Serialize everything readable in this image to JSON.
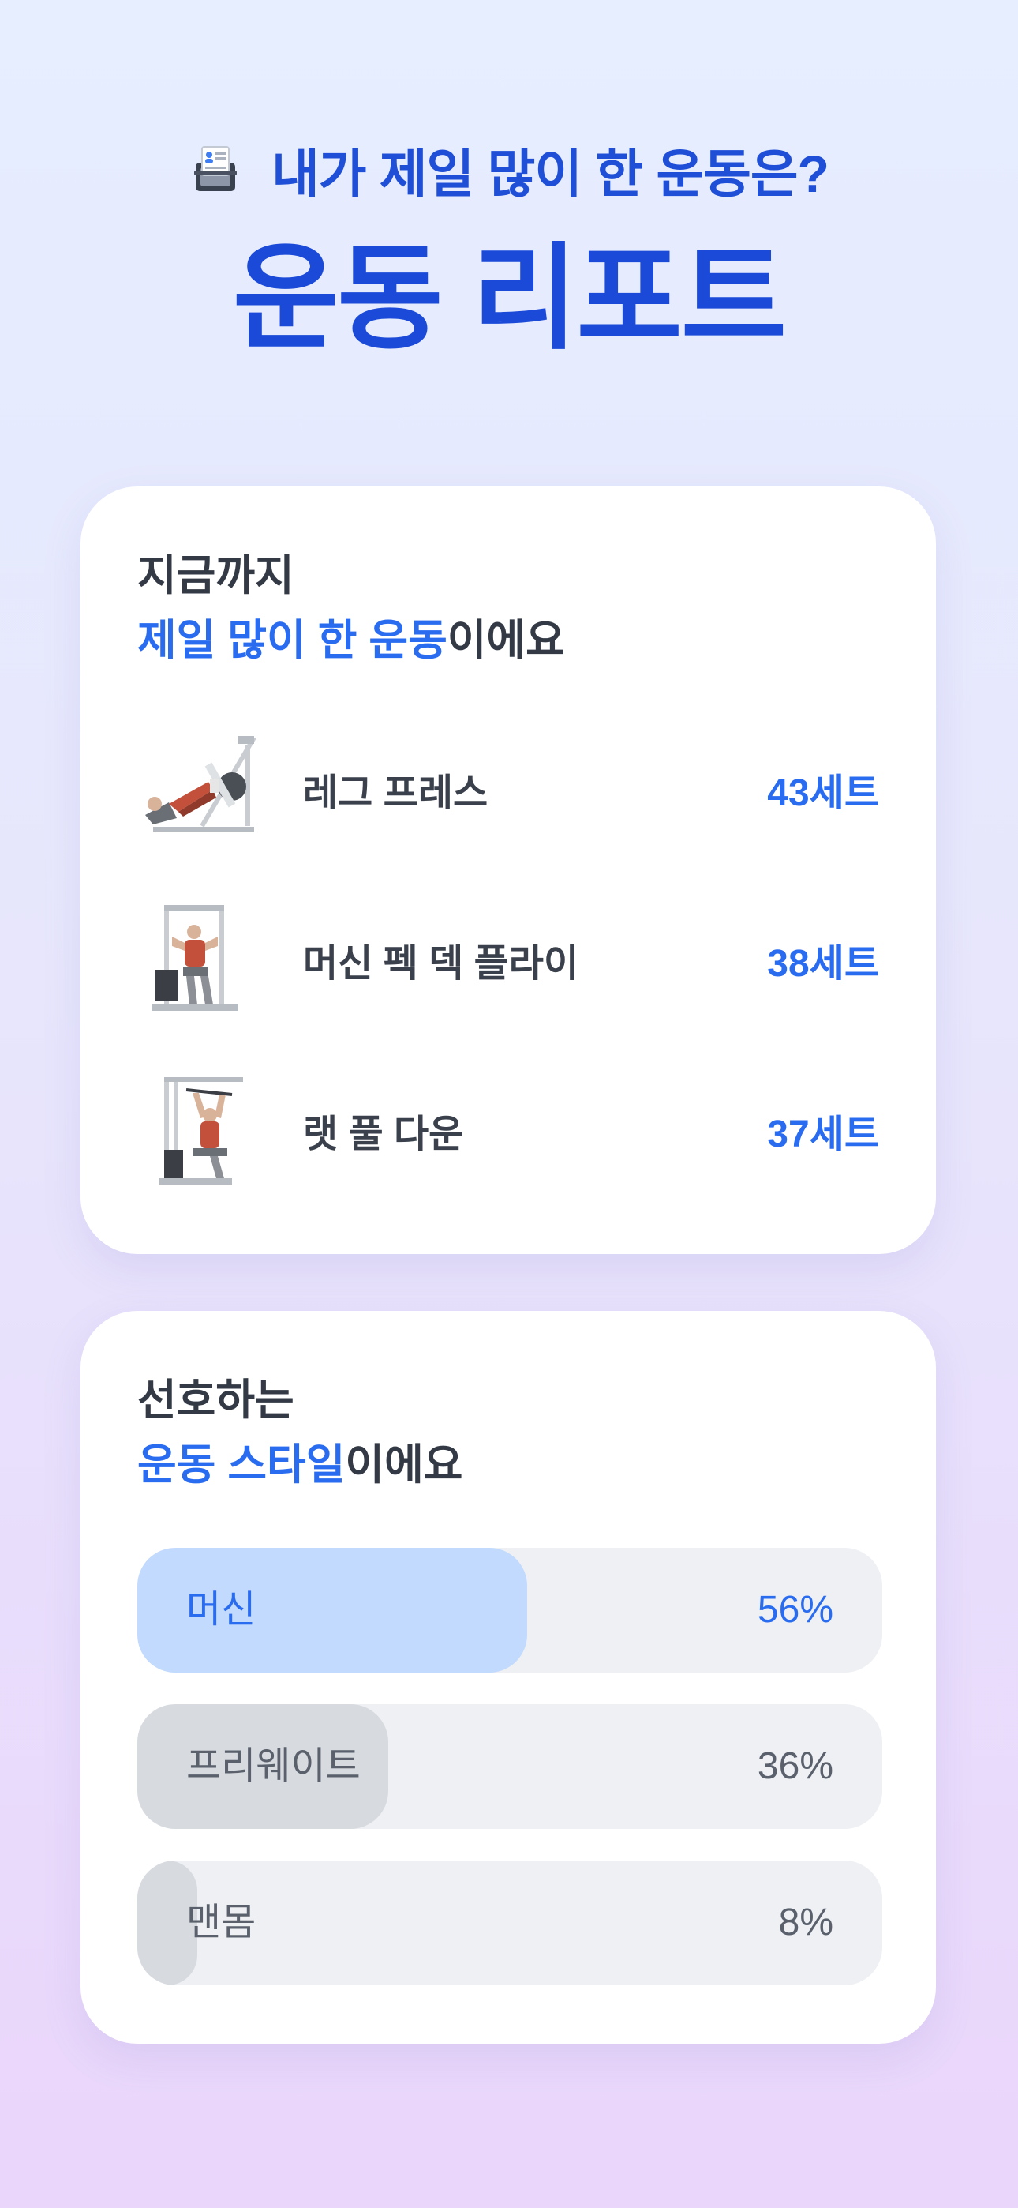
{
  "header": {
    "subtitle": "내가 제일 많이 한 운동은?",
    "title": "운동 리포트",
    "icon": "report-icon"
  },
  "top_exercises": {
    "heading_line1": "지금까지",
    "heading_accent": "제일 많이 한 운동",
    "heading_suffix": "이에요",
    "items": [
      {
        "name": "레그 프레스",
        "sets": "43세트",
        "icon": "leg-press-icon"
      },
      {
        "name": "머신 펙 덱 플라이",
        "sets": "38세트",
        "icon": "pec-deck-icon"
      },
      {
        "name": "랫 풀 다운",
        "sets": "37세트",
        "icon": "lat-pulldown-icon"
      }
    ]
  },
  "preferred_style": {
    "heading_line1": "선호하는",
    "heading_accent": "운동 스타일",
    "heading_suffix": "이에요",
    "items": [
      {
        "label": "머신",
        "percent_text": "56%",
        "value": 0.56,
        "fill_color": "#c1dafd",
        "text_color": "#2a6cf0"
      },
      {
        "label": "프리웨이트",
        "percent_text": "36%",
        "value": 0.36,
        "fill_color": "#d7dade",
        "text_color": "#5a616c"
      },
      {
        "label": "맨몸",
        "percent_text": "8%",
        "value": 0.08,
        "fill_color": "#d7dade",
        "text_color": "#5a616c"
      }
    ]
  },
  "colors": {
    "title_blue": "#1a4ad7",
    "accent_blue": "#2a6cf0",
    "text_dark": "#333a45"
  }
}
